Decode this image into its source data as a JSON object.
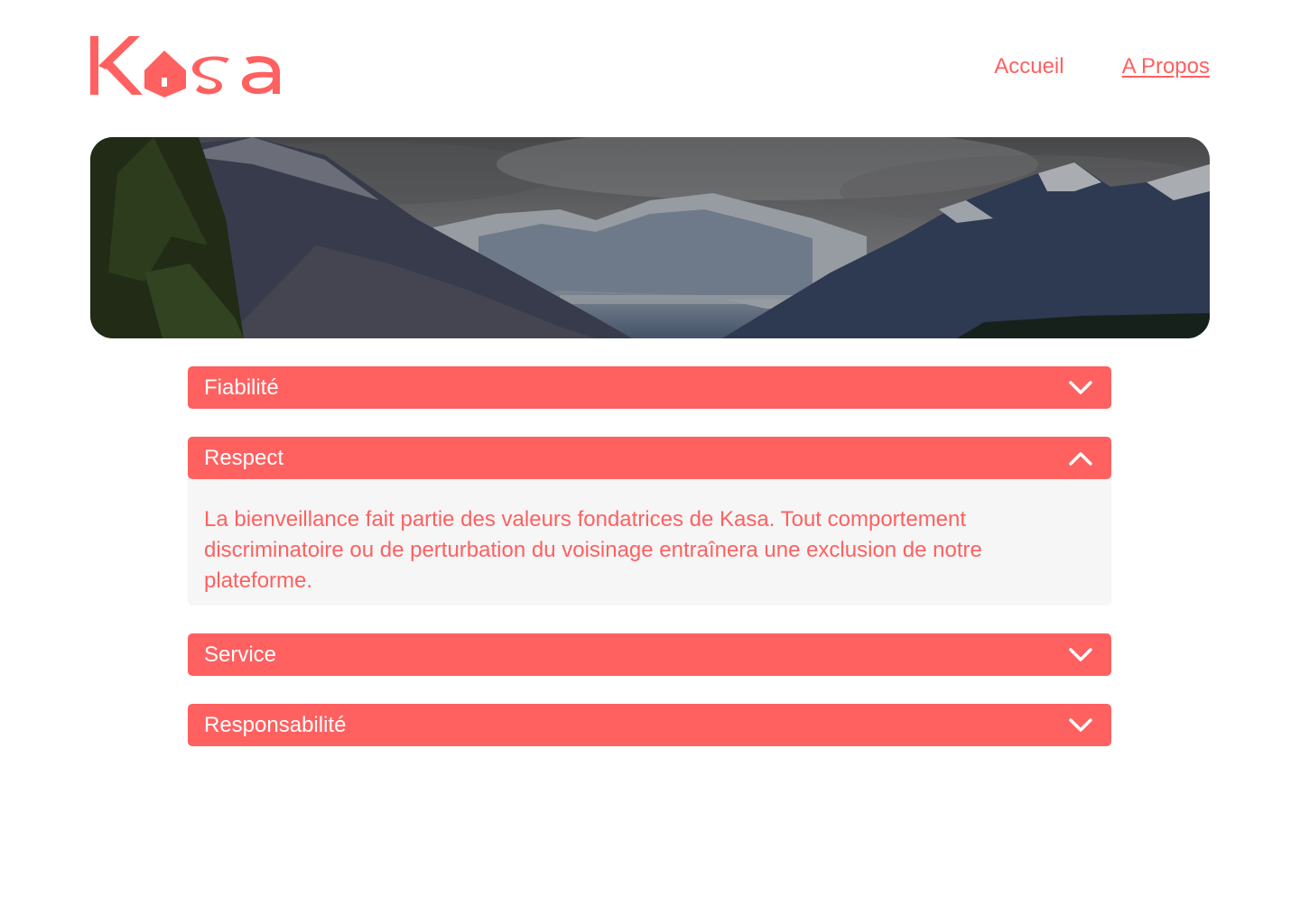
{
  "brand": {
    "logo_text": "Kasa",
    "accent_color": "#FF6060"
  },
  "nav": {
    "items": [
      {
        "label": "Accueil",
        "active": false
      },
      {
        "label": "A Propos",
        "active": true
      }
    ]
  },
  "banner": {
    "image": "mountain-landscape"
  },
  "collapses": [
    {
      "title": "Fiabilité",
      "open": false,
      "icon": "chevron-down-icon",
      "body": ""
    },
    {
      "title": "Respect",
      "open": true,
      "icon": "chevron-up-icon",
      "body": "La bienveillance fait partie des valeurs fondatrices de Kasa. Tout comportement discriminatoire ou de perturbation du voisinage entraînera une exclusion de notre plateforme."
    },
    {
      "title": "Service",
      "open": false,
      "icon": "chevron-down-icon",
      "body": ""
    },
    {
      "title": "Responsabilité",
      "open": false,
      "icon": "chevron-down-icon",
      "body": ""
    }
  ]
}
